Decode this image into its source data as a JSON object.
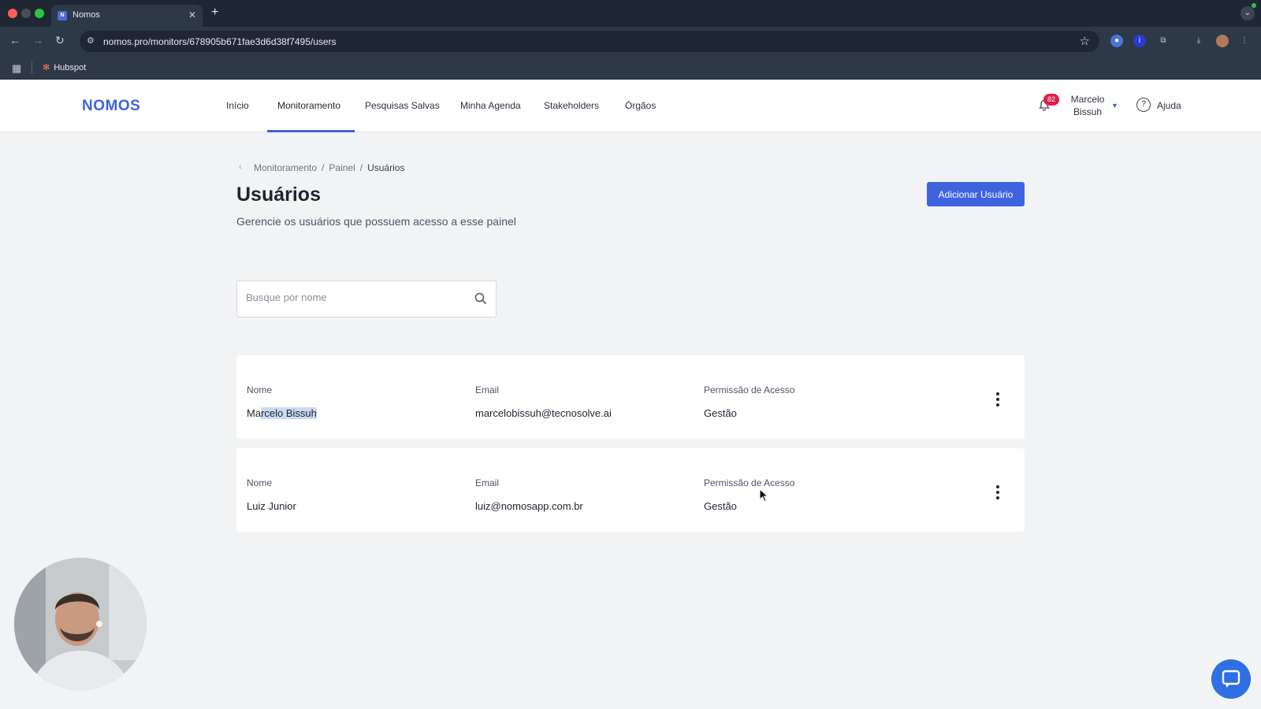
{
  "browser": {
    "tab_title": "Nomos",
    "tab_favicon": "N",
    "url": "nomos.pro/monitors/678905b671fae3d6d38f7495/users",
    "bookmarks": [
      {
        "label": "Hubspot"
      }
    ],
    "colors": {
      "frame": "#1e2733",
      "toolbar": "#2e3947"
    }
  },
  "header": {
    "logo": "NOMOS",
    "nav": [
      "Início",
      "Monitoramento",
      "Pesquisas Salvas",
      "Minha Agenda",
      "Stakeholders",
      "Órgãos"
    ],
    "active_nav": "Monitoramento",
    "notifications_count": "82",
    "user_first": "Marcelo",
    "user_last": "Bissuh",
    "help_label": "Ajuda"
  },
  "breadcrumb": [
    "Monitoramento",
    "Painel",
    "Usuários"
  ],
  "page": {
    "title": "Usuários",
    "subtitle": "Gerencie os usuários que possuem acesso a esse painel",
    "add_button": "Adicionar Usuário"
  },
  "search": {
    "placeholder": "Busque por nome",
    "value": ""
  },
  "columns": {
    "name": "Nome",
    "email": "Email",
    "permission": "Permissão de Acesso"
  },
  "users": [
    {
      "name_pre": "Ma",
      "name_sel": "rcelo Bissuh",
      "email": "marcelobissuh@tecnosolve.ai",
      "permission": "Gestão"
    },
    {
      "name": "Luiz Junior",
      "email": "luiz@nomosapp.com.br",
      "permission": "Gestão"
    }
  ],
  "colors": {
    "accent": "#3e63dd",
    "badge": "#e11d48",
    "selection": "#c9daf5"
  },
  "icons": [
    "search-icon",
    "bell-icon",
    "help-icon",
    "kebab-icon",
    "chat-icon",
    "chevron-left-icon",
    "star-icon"
  ]
}
